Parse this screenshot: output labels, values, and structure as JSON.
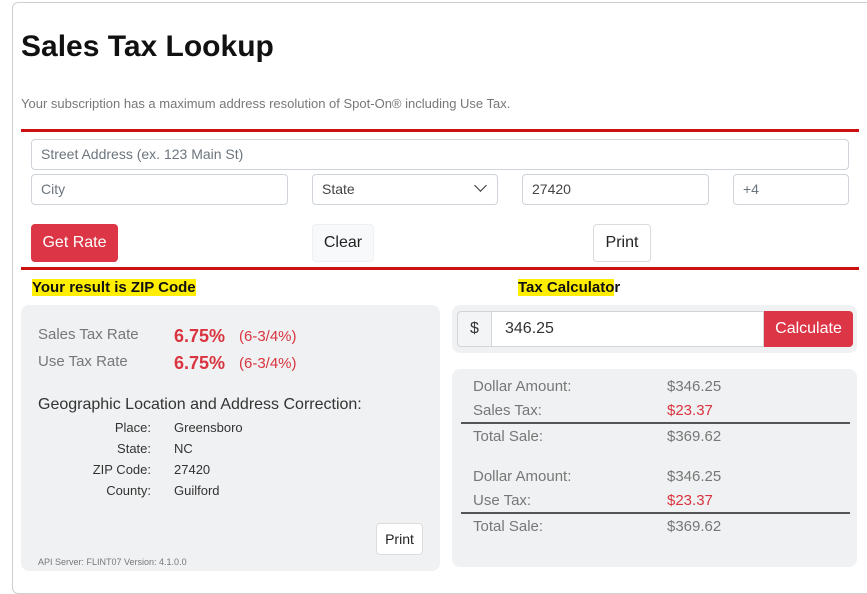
{
  "page": {
    "title": "Sales Tax Lookup",
    "subscription_note": "Your subscription has a maximum address resolution of Spot-On® including Use Tax."
  },
  "form": {
    "street_placeholder": "Street Address (ex. 123 Main St)",
    "city_placeholder": "City",
    "state_value": "State",
    "zip_value": "27420",
    "plus4_placeholder": "+4",
    "get_rate_label": "Get Rate",
    "clear_label": "Clear",
    "print_label": "Print"
  },
  "result": {
    "heading": "Your result is ZIP Code",
    "sales_tax_label": "Sales Tax Rate",
    "sales_tax_rate": "6.75%",
    "sales_tax_fraction": "(6-3/4%)",
    "use_tax_label": "Use Tax Rate",
    "use_tax_rate": "6.75%",
    "use_tax_fraction": "(6-3/4%)",
    "geo_heading": "Geographic Location and Address Correction:",
    "geo": [
      {
        "key": "Place:",
        "value": "Greensboro"
      },
      {
        "key": "State:",
        "value": "NC"
      },
      {
        "key": "ZIP Code:",
        "value": "27420"
      },
      {
        "key": "County:",
        "value": "Guilford"
      }
    ],
    "print_label": "Print",
    "api_info": "API Server: FLINT07 Version: 4.1.0.0"
  },
  "calculator": {
    "heading_part1": "Tax Calculato",
    "heading_part2": "r",
    "currency_symbol": "$",
    "amount_value": "346.25",
    "calculate_label": "Calculate",
    "sales": {
      "dollar_label": "Dollar Amount:",
      "dollar_value": "$346.25",
      "tax_label": "Sales Tax:",
      "tax_value": "$23.37",
      "total_label": "Total Sale:",
      "total_value": "$369.62"
    },
    "use": {
      "dollar_label": "Dollar Amount:",
      "dollar_value": "$346.25",
      "tax_label": "Use Tax:",
      "tax_value": "$23.37",
      "total_label": "Total Sale:",
      "total_value": "$369.62"
    }
  },
  "colors": {
    "accent_red": "#dc3545",
    "rule_red": "#cc1111",
    "highlight_yellow": "#ffee00"
  }
}
